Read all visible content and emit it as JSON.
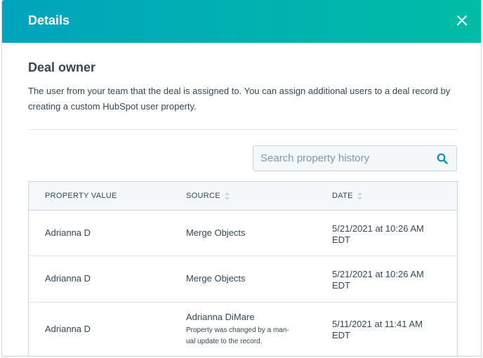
{
  "header": {
    "title": "Details",
    "close_icon": "close-icon"
  },
  "section": {
    "title": "Deal owner",
    "description": "The user from your team that the deal is assigned to. You can assign additional users to a deal record by creating a custom HubSpot user property."
  },
  "search": {
    "placeholder": "Search property history",
    "icon": "search-icon"
  },
  "table": {
    "headers": {
      "value": "PROPERTY VALUE",
      "source": "SOURCE",
      "date": "DATE"
    },
    "rows": [
      {
        "value": "Adrianna D",
        "source": "Merge Objects",
        "date_line1": "5/21/2021 at 10:26 AM",
        "date_line2": "EDT"
      },
      {
        "value": "Adrianna D",
        "source": "Merge Objects",
        "date_line1": "5/21/2021 at 10:26 AM",
        "date_line2": "EDT"
      },
      {
        "value": "Adrianna D",
        "source": "Adrianna DiMare",
        "source_sub_line1": "Property was changed by a man-",
        "source_sub_line2": "ual update to the record.",
        "date_line1": "5/11/2021 at 11:41 AM",
        "date_line2": "EDT"
      }
    ]
  },
  "colors": {
    "header_gradient_start": "#00a4bd",
    "header_gradient_end": "#00bda5",
    "text": "#33475b",
    "link": "#0091ae"
  }
}
